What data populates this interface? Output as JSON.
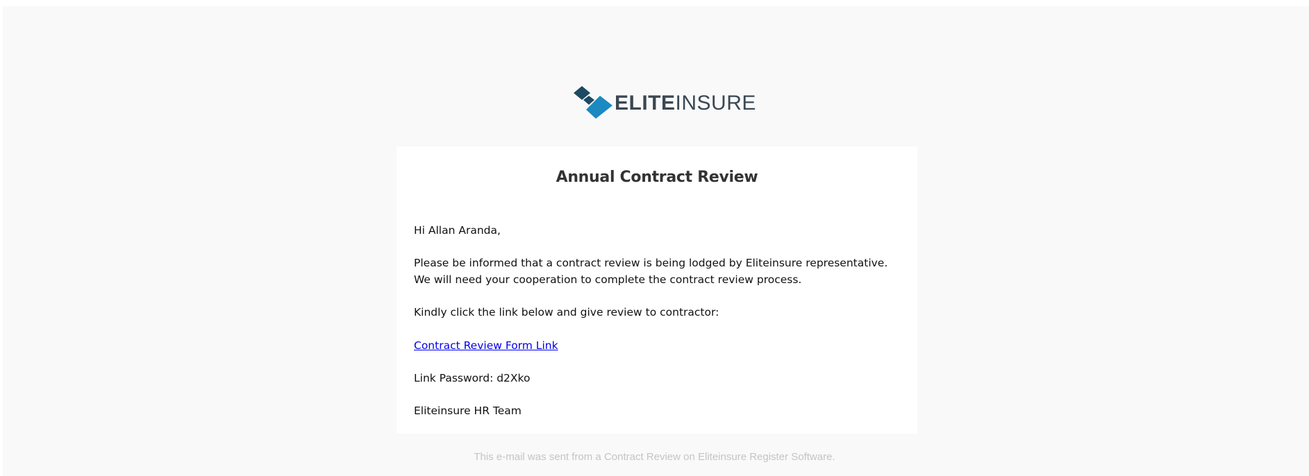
{
  "brand": {
    "logo_bold": "ELITE",
    "logo_light": "INSURE",
    "colors": {
      "dark": "#1c4a63",
      "light": "#1a8ac1",
      "text": "#3b4854"
    }
  },
  "email": {
    "title": "Annual Contract Review",
    "greeting": "Hi Allan Aranda,",
    "paragraph1": "Please be informed that a contract review is being lodged by Eliteinsure representative. We will need your cooperation to complete the contract review process.",
    "paragraph2": "Kindly click the link below and give review to contractor:",
    "link_text": "Contract Review Form Link",
    "password": "Link Password: d2Xko",
    "signature": "Eliteinsure HR Team"
  },
  "footer": {
    "text": "This e-mail was sent from a Contract Review on Eliteinsure Register Software."
  }
}
